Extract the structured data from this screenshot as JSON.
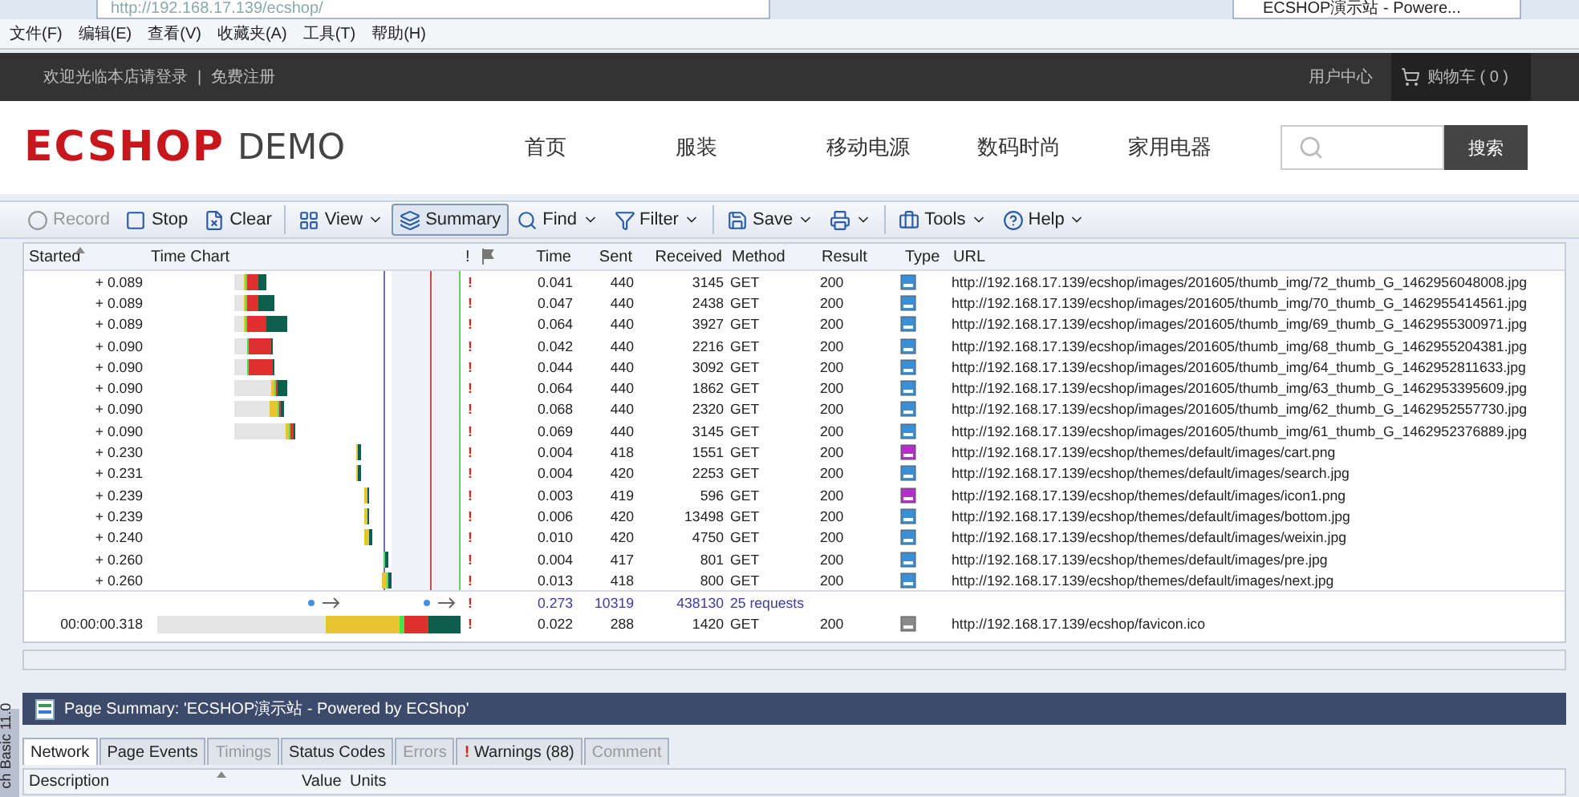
{
  "browser": {
    "address": "http://192.168.17.139/ecshop/",
    "tab": "ECSHOP演示站 - Powere...",
    "menu": [
      "文件(F)",
      "编辑(E)",
      "查看(V)",
      "收藏夹(A)",
      "工具(T)",
      "帮助(H)"
    ]
  },
  "site": {
    "welcome": "欢迎光临本店请登录",
    "separator": "|",
    "register": "免费注册",
    "user_center": "用户中心",
    "cart": "购物车 ( 0 )",
    "logo": "ECSHOP",
    "logo_suffix": "DEMO",
    "nav": [
      "首页",
      "服装",
      "移动电源",
      "数码时尚",
      "家用电器"
    ],
    "search_button": "搜索"
  },
  "toolbar": [
    [
      {
        "label": "Record",
        "dropdown": false,
        "disabled": true,
        "selected": false
      },
      {
        "label": "Stop",
        "dropdown": false,
        "disabled": false,
        "selected": false
      },
      {
        "label": "Clear",
        "dropdown": false,
        "disabled": false,
        "selected": false
      }
    ],
    [
      {
        "label": "View",
        "dropdown": true,
        "disabled": false,
        "selected": false
      },
      {
        "label": "Summary",
        "dropdown": false,
        "disabled": false,
        "selected": true
      },
      {
        "label": "Find",
        "dropdown": true,
        "disabled": false,
        "selected": false
      },
      {
        "label": "Filter",
        "dropdown": true,
        "disabled": false,
        "selected": false
      }
    ],
    [
      {
        "label": "Save",
        "dropdown": true,
        "disabled": false,
        "selected": false
      },
      {
        "dropdown": true,
        "disabled": false,
        "selected": false
      }
    ],
    [
      {
        "label": "Tools",
        "dropdown": true,
        "disabled": false,
        "selected": false
      },
      {
        "label": "Help",
        "dropdown": true,
        "disabled": false,
        "selected": false
      }
    ]
  ],
  "columns": [
    {
      "label": "Started",
      "sorted": true
    },
    {
      "label": "Time Chart"
    },
    {
      "label": "!"
    },
    {
      "label": "Time"
    },
    {
      "label": "Sent"
    },
    {
      "label": "Received"
    },
    {
      "label": "Method"
    },
    {
      "label": "Result"
    },
    {
      "label": "Type"
    },
    {
      "label": "URL"
    }
  ],
  "rows": [
    {
      "started": "+ 0.089",
      "alert": "!",
      "time": "0.041",
      "sent": "440",
      "received": "3145",
      "method": "GET",
      "result": "200",
      "color": "#3b8fd4",
      "url": "http://192.168.17.139/ecshop/images/201605/thumb_img/72_thumb_G_1462956048008.jpg"
    },
    {
      "started": "+ 0.089",
      "alert": "!",
      "time": "0.047",
      "sent": "440",
      "received": "2438",
      "method": "GET",
      "result": "200",
      "color": "#3b8fd4",
      "url": "http://192.168.17.139/ecshop/images/201605/thumb_img/70_thumb_G_1462955414561.jpg"
    },
    {
      "started": "+ 0.089",
      "alert": "!",
      "time": "0.064",
      "sent": "440",
      "received": "3927",
      "method": "GET",
      "result": "200",
      "color": "#3b8fd4",
      "url": "http://192.168.17.139/ecshop/images/201605/thumb_img/69_thumb_G_1462955300971.jpg"
    },
    {
      "started": "+ 0.090",
      "alert": "!",
      "time": "0.042",
      "sent": "440",
      "received": "2216",
      "method": "GET",
      "result": "200",
      "color": "#3b8fd4",
      "url": "http://192.168.17.139/ecshop/images/201605/thumb_img/68_thumb_G_1462955204381.jpg"
    },
    {
      "started": "+ 0.090",
      "alert": "!",
      "time": "0.044",
      "sent": "440",
      "received": "3092",
      "method": "GET",
      "result": "200",
      "color": "#3b8fd4",
      "url": "http://192.168.17.139/ecshop/images/201605/thumb_img/64_thumb_G_1462952811633.jpg"
    },
    {
      "started": "+ 0.090",
      "alert": "!",
      "time": "0.064",
      "sent": "440",
      "received": "1862",
      "method": "GET",
      "result": "200",
      "color": "#3b8fd4",
      "url": "http://192.168.17.139/ecshop/images/201605/thumb_img/63_thumb_G_1462953395609.jpg"
    },
    {
      "started": "+ 0.090",
      "alert": "!",
      "time": "0.068",
      "sent": "440",
      "received": "2320",
      "method": "GET",
      "result": "200",
      "color": "#3b8fd4",
      "url": "http://192.168.17.139/ecshop/images/201605/thumb_img/62_thumb_G_1462952557730.jpg"
    },
    {
      "started": "+ 0.090",
      "alert": "!",
      "time": "0.069",
      "sent": "440",
      "received": "3145",
      "method": "GET",
      "result": "200",
      "color": "#3b8fd4",
      "url": "http://192.168.17.139/ecshop/images/201605/thumb_img/61_thumb_G_1462952376889.jpg"
    },
    {
      "started": "+ 0.230",
      "alert": "!",
      "time": "0.004",
      "sent": "418",
      "received": "1551",
      "method": "GET",
      "result": "200",
      "color": "#b030c8",
      "url": "http://192.168.17.139/ecshop/themes/default/images/cart.png"
    },
    {
      "started": "+ 0.231",
      "alert": "!",
      "time": "0.004",
      "sent": "420",
      "received": "2253",
      "method": "GET",
      "result": "200",
      "color": "#3b8fd4",
      "url": "http://192.168.17.139/ecshop/themes/default/images/search.jpg"
    },
    {
      "started": "+ 0.239",
      "alert": "!",
      "time": "0.003",
      "sent": "419",
      "received": "596",
      "method": "GET",
      "result": "200",
      "color": "#b030c8",
      "url": "http://192.168.17.139/ecshop/themes/default/images/icon1.png"
    },
    {
      "started": "+ 0.239",
      "alert": "!",
      "time": "0.006",
      "sent": "420",
      "received": "13498",
      "method": "GET",
      "result": "200",
      "color": "#3b8fd4",
      "url": "http://192.168.17.139/ecshop/themes/default/images/bottom.jpg"
    },
    {
      "started": "+ 0.240",
      "alert": "!",
      "time": "0.010",
      "sent": "420",
      "received": "4750",
      "method": "GET",
      "result": "200",
      "color": "#3b8fd4",
      "url": "http://192.168.17.139/ecshop/themes/default/images/weixin.jpg"
    },
    {
      "started": "+ 0.260",
      "alert": "!",
      "time": "0.004",
      "sent": "417",
      "received": "801",
      "method": "GET",
      "result": "200",
      "color": "#3b8fd4",
      "url": "http://192.168.17.139/ecshop/themes/default/images/pre.jpg"
    },
    {
      "started": "+ 0.260",
      "alert": "!",
      "time": "0.013",
      "sent": "418",
      "received": "800",
      "method": "GET",
      "result": "200",
      "color": "#3b8fd4",
      "url": "http://192.168.17.139/ecshop/themes/default/images/next.jpg"
    }
  ],
  "totals": {
    "alert": "!",
    "time": "0.273",
    "sent": "10319",
    "received": "438130",
    "requests": "25 requests"
  },
  "last_row": {
    "started": "00:00:00.318",
    "alert": "!",
    "time": "0.022",
    "sent": "288",
    "received": "1420",
    "method": "GET",
    "result": "200",
    "color": "#8a8a8a",
    "url": "http://192.168.17.139/ecshop/favicon.ico"
  },
  "page_summary": "Page Summary: 'ECSHOP演示站 - Powered by ECShop'",
  "tabs": [
    {
      "label": "Network",
      "selected": true,
      "disabled": false
    },
    {
      "label": "Page Events",
      "selected": false,
      "disabled": false
    },
    {
      "label": "Timings",
      "selected": false,
      "disabled": true
    },
    {
      "label": "Status Codes",
      "selected": false,
      "disabled": false
    },
    {
      "label": "Errors",
      "selected": false,
      "disabled": true
    },
    {
      "label": "Warnings (88)",
      "alert": "!",
      "selected": false,
      "disabled": false
    },
    {
      "label": "Comment",
      "selected": false,
      "disabled": true
    }
  ],
  "summary_columns": [
    {
      "label": "Description",
      "sorted": true
    },
    {
      "label": "Value"
    },
    {
      "label": "Units"
    }
  ],
  "side_label": "ch Basic 11.0"
}
